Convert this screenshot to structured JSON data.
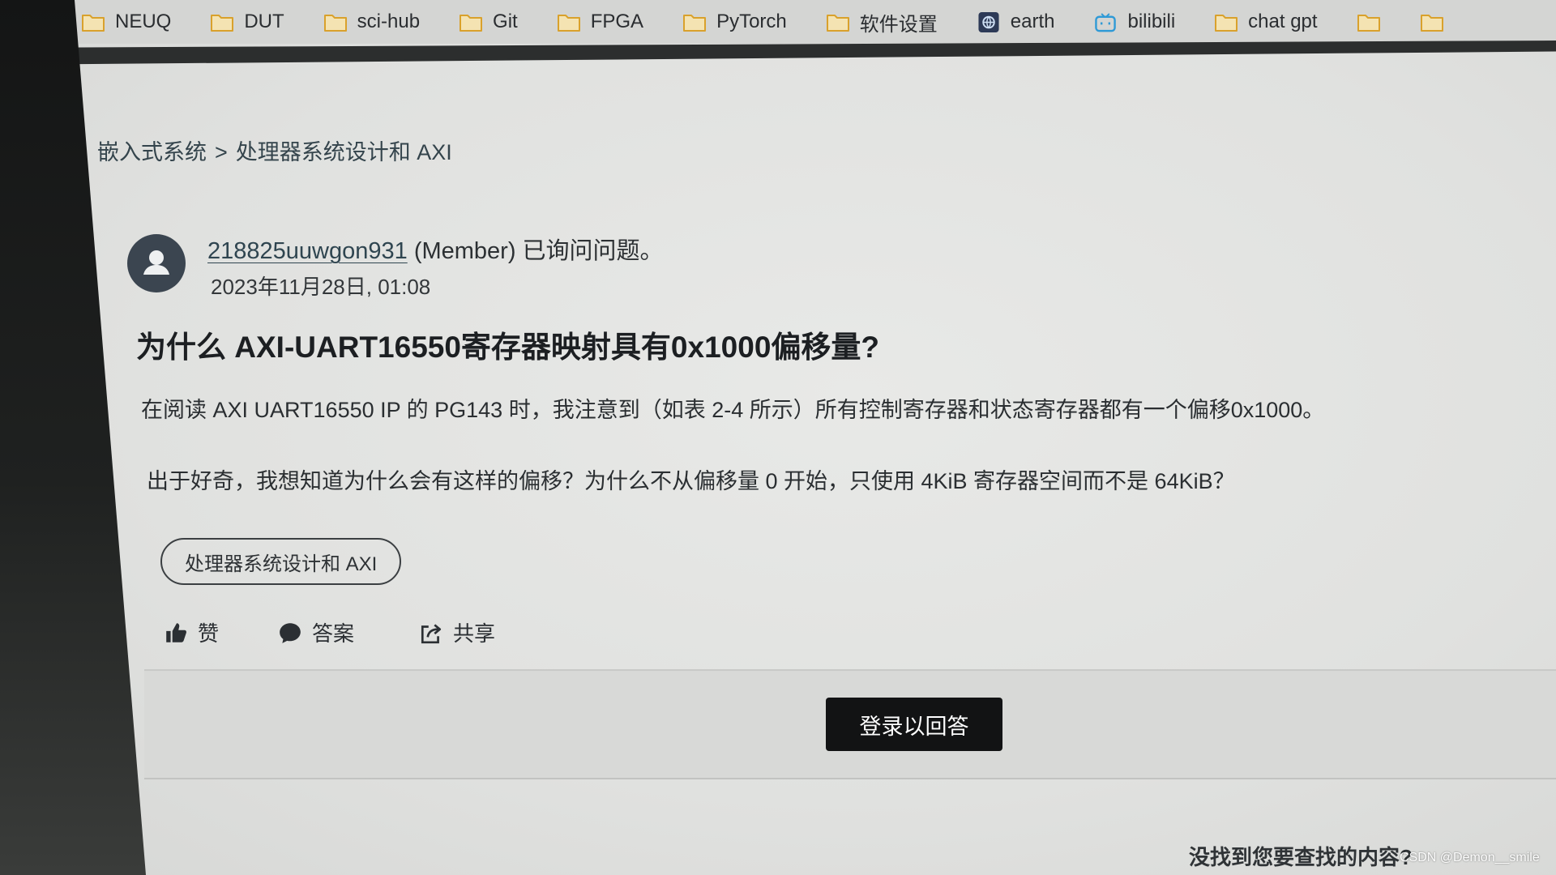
{
  "bookmarks": [
    {
      "label": "NEUQ",
      "icon": "folder-icon"
    },
    {
      "label": "DUT",
      "icon": "folder-icon"
    },
    {
      "label": "sci-hub",
      "icon": "folder-icon"
    },
    {
      "label": "Git",
      "icon": "folder-icon"
    },
    {
      "label": "FPGA",
      "icon": "folder-icon"
    },
    {
      "label": "PyTorch",
      "icon": "folder-icon"
    },
    {
      "label": "软件设置",
      "icon": "folder-icon"
    },
    {
      "label": "earth",
      "icon": "earth-app-icon"
    },
    {
      "label": "bilibili",
      "icon": "bilibili-tv-icon"
    },
    {
      "label": "chat gpt",
      "icon": "folder-icon"
    },
    {
      "icon": "folder-icon"
    },
    {
      "icon": "folder-icon"
    }
  ],
  "breadcrumb": {
    "parent": "嵌入式系统",
    "separator": ">",
    "current": "处理器系统设计和 AXI"
  },
  "post": {
    "author": "218825uuwgon931",
    "author_role": "(Member)",
    "action_text": "已询问问题。",
    "date": "2023年11月28日, 01:08",
    "title": "为什么 AXI-UART16550寄存器映射具有0x1000偏移量?",
    "paragraphs": [
      "在阅读 AXI UART16550 IP 的 PG143 时，我注意到（如表 2-4 所示）所有控制寄存器和状态寄存器都有一个偏移0x1000。",
      "出于好奇，我想知道为什么会有这样的偏移？为什么不从偏移量 0 开始，只使用 4KiB 寄存器空间而不是 64KiB？"
    ],
    "tag": "处理器系统设计和 AXI"
  },
  "actions": {
    "like": {
      "label": "赞",
      "icon": "thumbs-up-icon"
    },
    "answer": {
      "label": "答案",
      "icon": "speech-bubble-icon"
    },
    "share": {
      "label": "共享",
      "icon": "share-icon"
    }
  },
  "login_button": "登录以回答",
  "footer_prompt": "没找到您要查找的内容?",
  "watermark": "CSDN @Demon__smile",
  "colors": {
    "login_button_bg": "#121314",
    "avatar_bg": "#3b4550",
    "folder_icon": "#d9a12c"
  }
}
